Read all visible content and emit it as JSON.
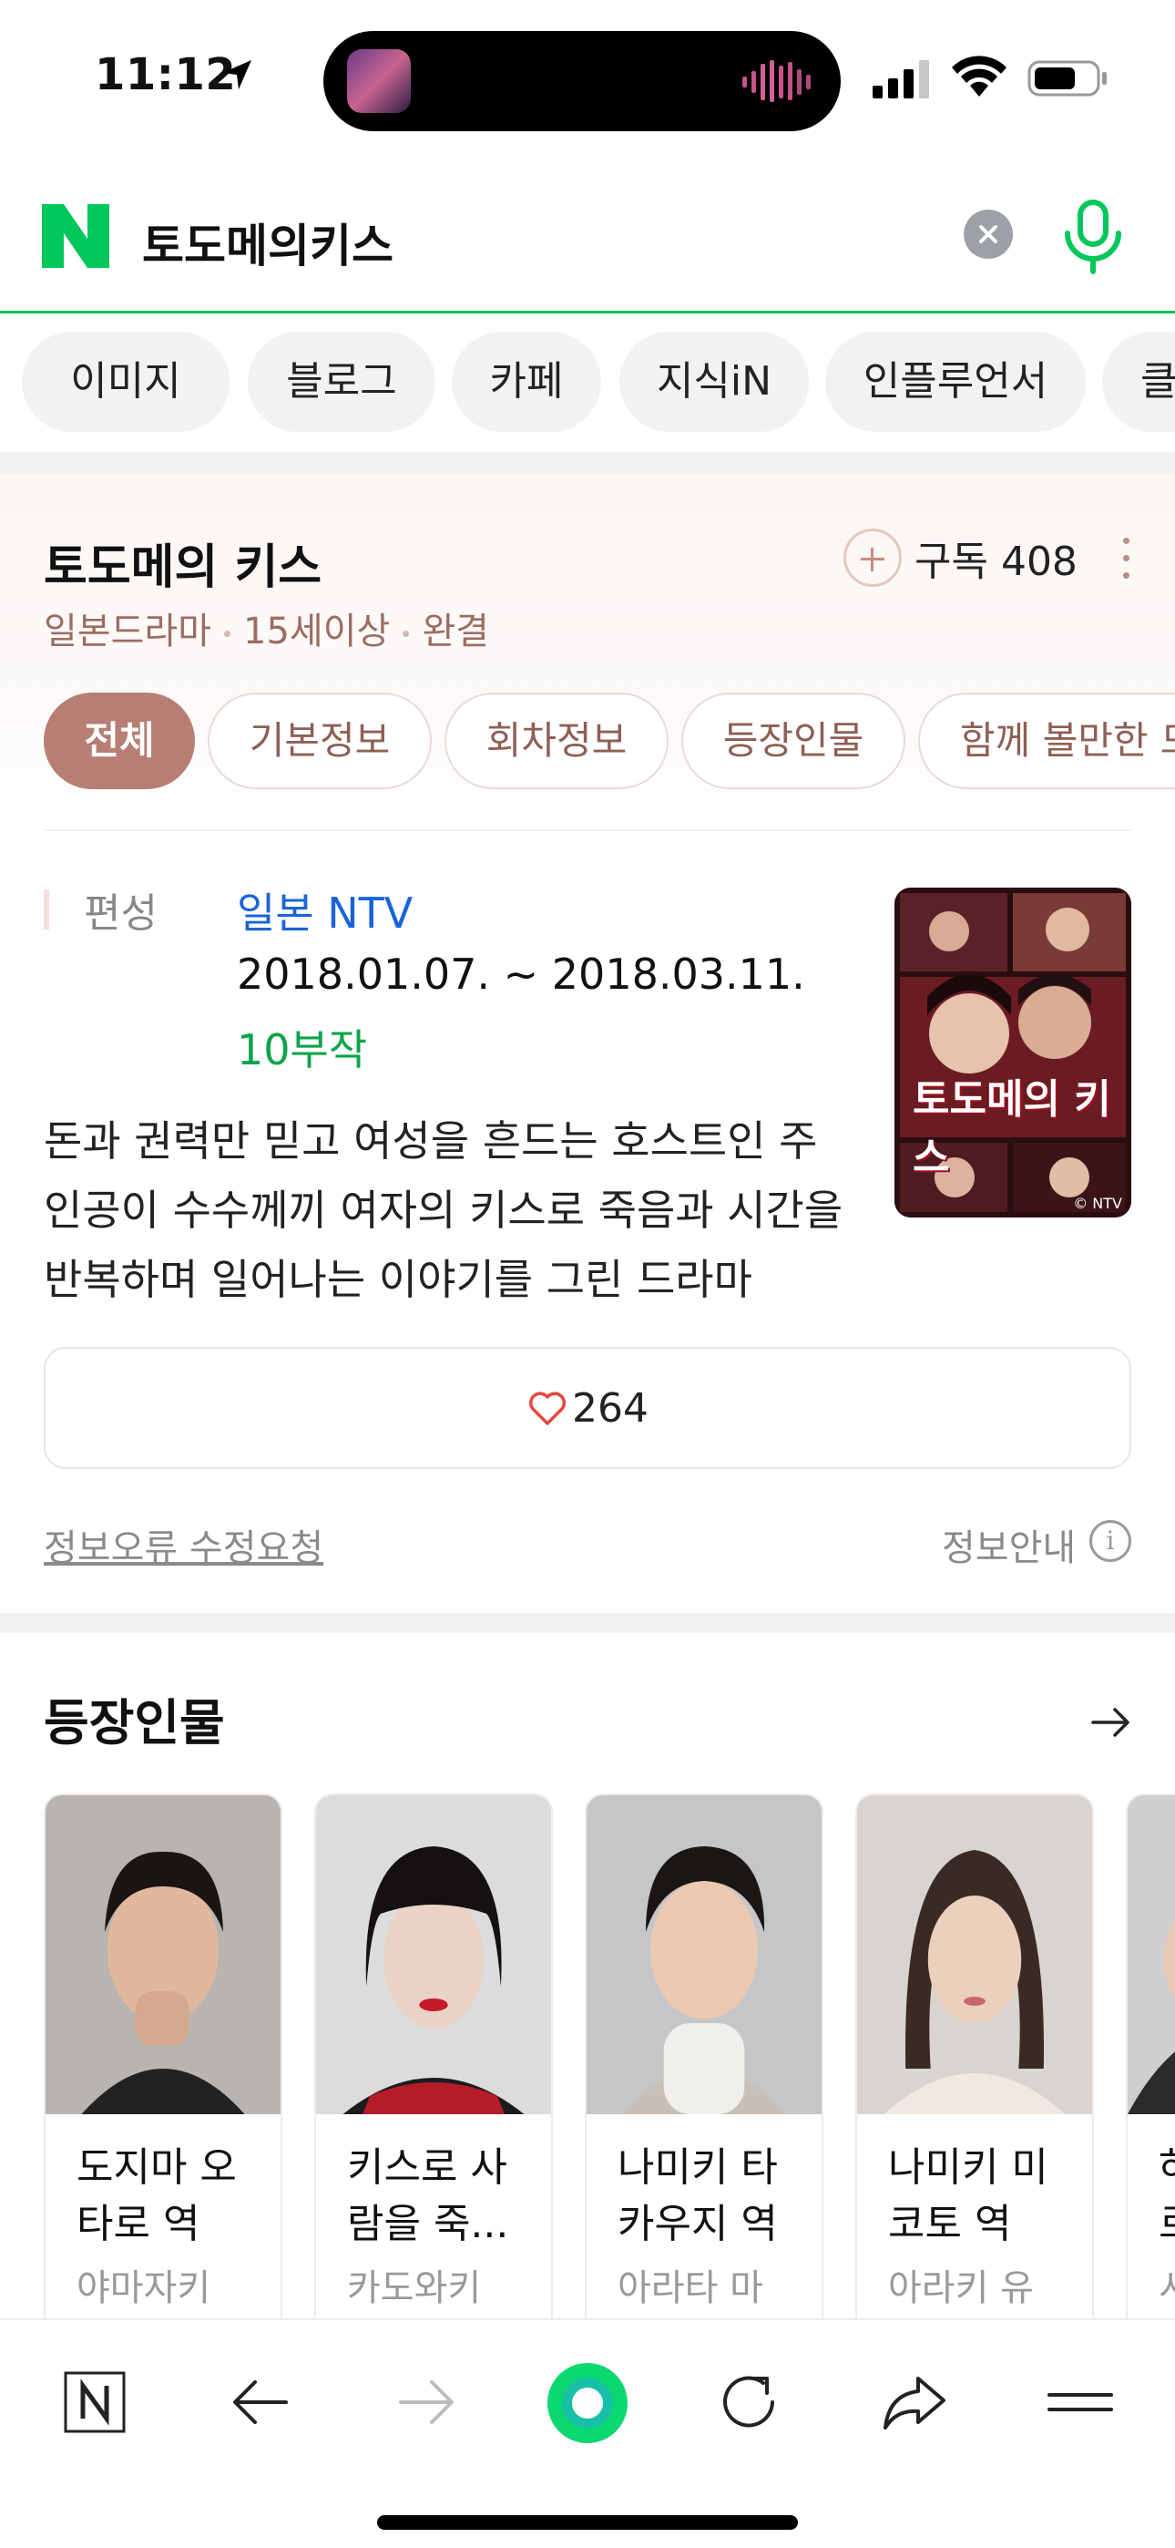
{
  "status": {
    "time": "11:12"
  },
  "search": {
    "query": "토도메의키스"
  },
  "categories": [
    "이미지",
    "블로그",
    "카페",
    "지식iN",
    "인플루언서",
    "클"
  ],
  "card": {
    "title": "토도메의 키스",
    "subscribe_label": "구독 408",
    "meta": [
      "일본드라마",
      "15세이상",
      "완결"
    ],
    "tabs": [
      "전체",
      "기본정보",
      "회차정보",
      "등장인물",
      "함께 볼만한 드"
    ],
    "pub_label": "편성",
    "network": "일본 NTV",
    "dates": "2018.01.07. ~ 2018.03.11.",
    "episodes": "10부작",
    "synopsis_lines": [
      "돈과 권력만 믿고 여성을 흔드는 호스트인 주",
      "인공이 수수께끼 여자의 키스로 죽음과 시간을",
      "반복하며 일어나는 이야기를 그린 드라마"
    ],
    "poster_title": "토도메의 키스",
    "poster_logo": "© NTV",
    "like_count": "264",
    "report_link": "정보오류 수정요청",
    "info_guide": "정보안내",
    "info_icon": "i"
  },
  "characters": {
    "title": "등장인물",
    "items": [
      {
        "role_lines": [
          "도지마 오",
          "타로 역"
        ],
        "actor": "야마자키"
      },
      {
        "role_lines": [
          "키스로 사",
          "람을 죽..."
        ],
        "actor": "카도와키"
      },
      {
        "role_lines": [
          "나미키 타",
          "카우지 역"
        ],
        "actor": "아라타 마"
      },
      {
        "role_lines": [
          "나미키 미",
          "코토 역"
        ],
        "actor": "아라키 유"
      },
      {
        "role_lines": [
          "하",
          "로"
        ],
        "actor": "시"
      }
    ]
  },
  "colors": {
    "naver_green": "#03c75a",
    "accent_brown": "#b77e73",
    "link_blue": "#1b64d8",
    "episode_green": "#0aa44a"
  },
  "icons": {
    "toolbar": [
      "naver-home-icon",
      "back-icon",
      "forward-icon",
      "green-dot-icon",
      "refresh-icon",
      "share-icon",
      "menu-icon"
    ]
  }
}
